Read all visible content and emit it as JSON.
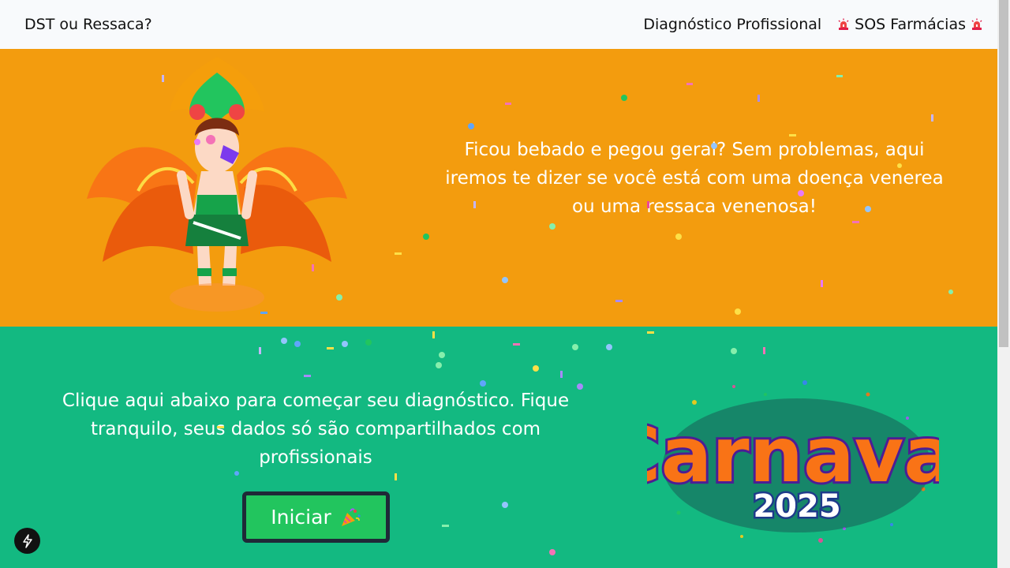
{
  "navbar": {
    "brand": "DST ou Ressaca?",
    "links": [
      {
        "label": "Diagnóstico Profissional"
      },
      {
        "label": "SOS Farmácias",
        "icon": "siren-icon"
      }
    ]
  },
  "hero": {
    "text": "Ficou bebado e pegou geral? Sem problemas, aqui iremos te dizer se você está com uma doença venerea ou uma ressaca venenosa!",
    "image": "carnival-dancer-image",
    "background_color": "#f39c0e"
  },
  "cta": {
    "text": "Clique aqui abaixo para começar seu diagnóstico. Fique tranquilo, seus dados só são compartilhados com profissionais",
    "button_label": "Iniciar",
    "button_icon": "party-popper-icon",
    "background_color": "#13b981",
    "button_color": "#22c55e"
  },
  "logo": {
    "word": "Carnaval",
    "year": "2025"
  },
  "fab_icon": "lightning-icon"
}
